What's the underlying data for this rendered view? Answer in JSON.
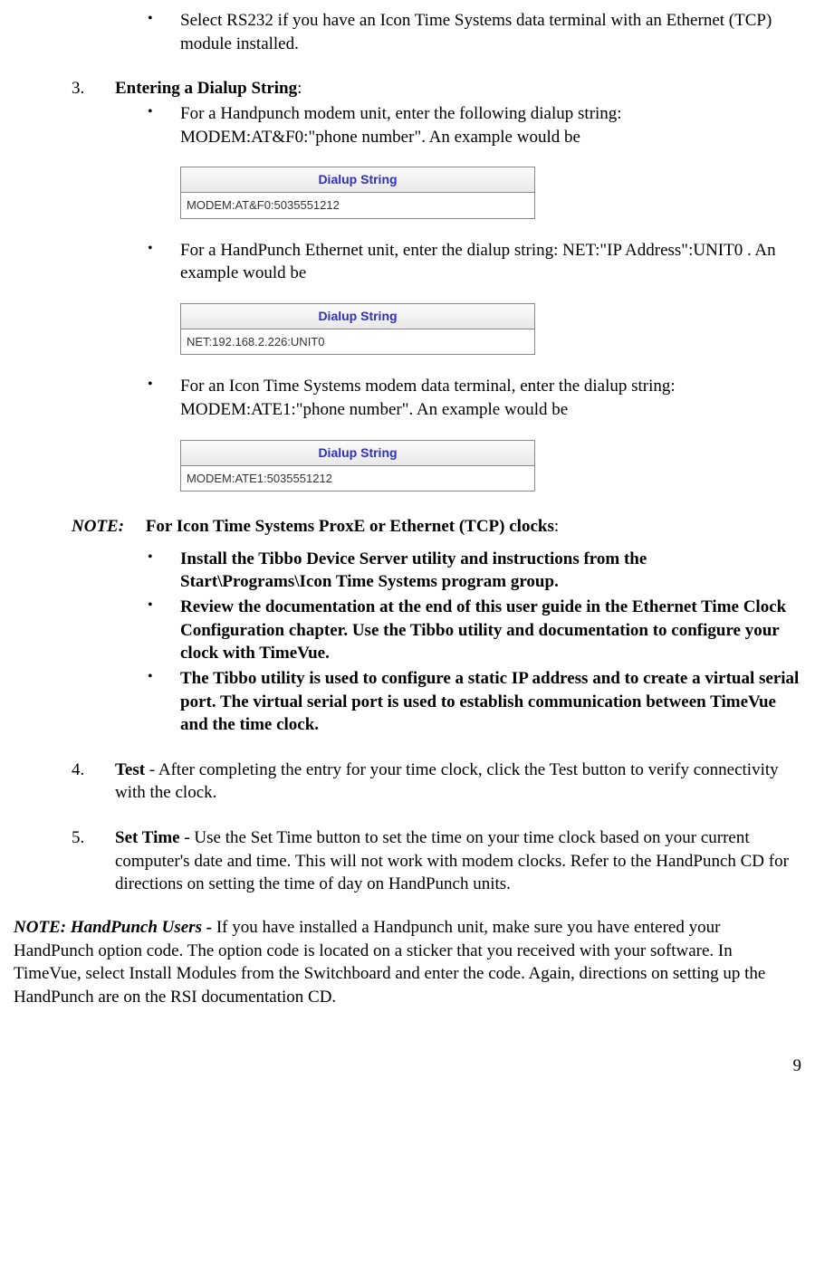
{
  "top_bullet": "Select RS232 if you have an Icon Time Systems data terminal with an Ethernet (TCP) module installed.",
  "item3": {
    "num": "3.",
    "title": "Entering a Dialup String",
    "bullet1": "For a Handpunch modem unit, enter the following dialup string:  MODEM:AT&F0:\"phone number\".  An example would be",
    "bullet2": "For a HandPunch Ethernet unit, enter the dialup string:  NET:\"IP Address\":UNIT0 .  An example would be",
    "bullet3": "For an Icon Time Systems modem data terminal, enter the dialup string:  MODEM:ATE1:\"phone number\".  An example would be"
  },
  "dialup": {
    "header": "Dialup String",
    "value1": "MODEM:AT&F0:5035551212",
    "value2": "NET:192.168.2.226:UNIT0",
    "value3": "MODEM:ATE1:5035551212"
  },
  "note_top": {
    "label": "NOTE:",
    "text": "For Icon Time Systems ProxE or Ethernet (TCP) clocks",
    "b1": "Install the Tibbo Device Server utility and instructions from the Start\\Programs\\Icon Time Systems program group.",
    "b2": "Review the documentation at the end of this user guide in the Ethernet Time Clock Configuration chapter.  Use the Tibbo utility and documentation to configure your clock with TimeVue.",
    "b3": "The Tibbo utility is used to configure a static IP address and to create a virtual serial port.  The virtual serial port is used to establish communication between TimeVue and the time clock."
  },
  "item4": {
    "num": "4.",
    "title": "Test",
    "text": " - After completing the entry for your time clock, click the Test button to verify connectivity with the clock."
  },
  "item5": {
    "num": "5.",
    "title": "Set Time",
    "text": " - Use the Set Time button to set the time on your time clock based on your current computer's date and time.  This will not work with modem clocks.  Refer to the HandPunch CD for directions on setting the time of day on HandPunch units."
  },
  "bottom_note": {
    "label": "NOTE: HandPunch Users - ",
    "text": "If you have installed a Handpunch unit, make sure you have entered your HandPunch option code.  The option code is located on a sticker that you received with your software.  In TimeVue, select Install Modules from the Switchboard and enter the code.  Again, directions on setting up the HandPunch are on the RSI documentation CD."
  },
  "page_number": "9"
}
